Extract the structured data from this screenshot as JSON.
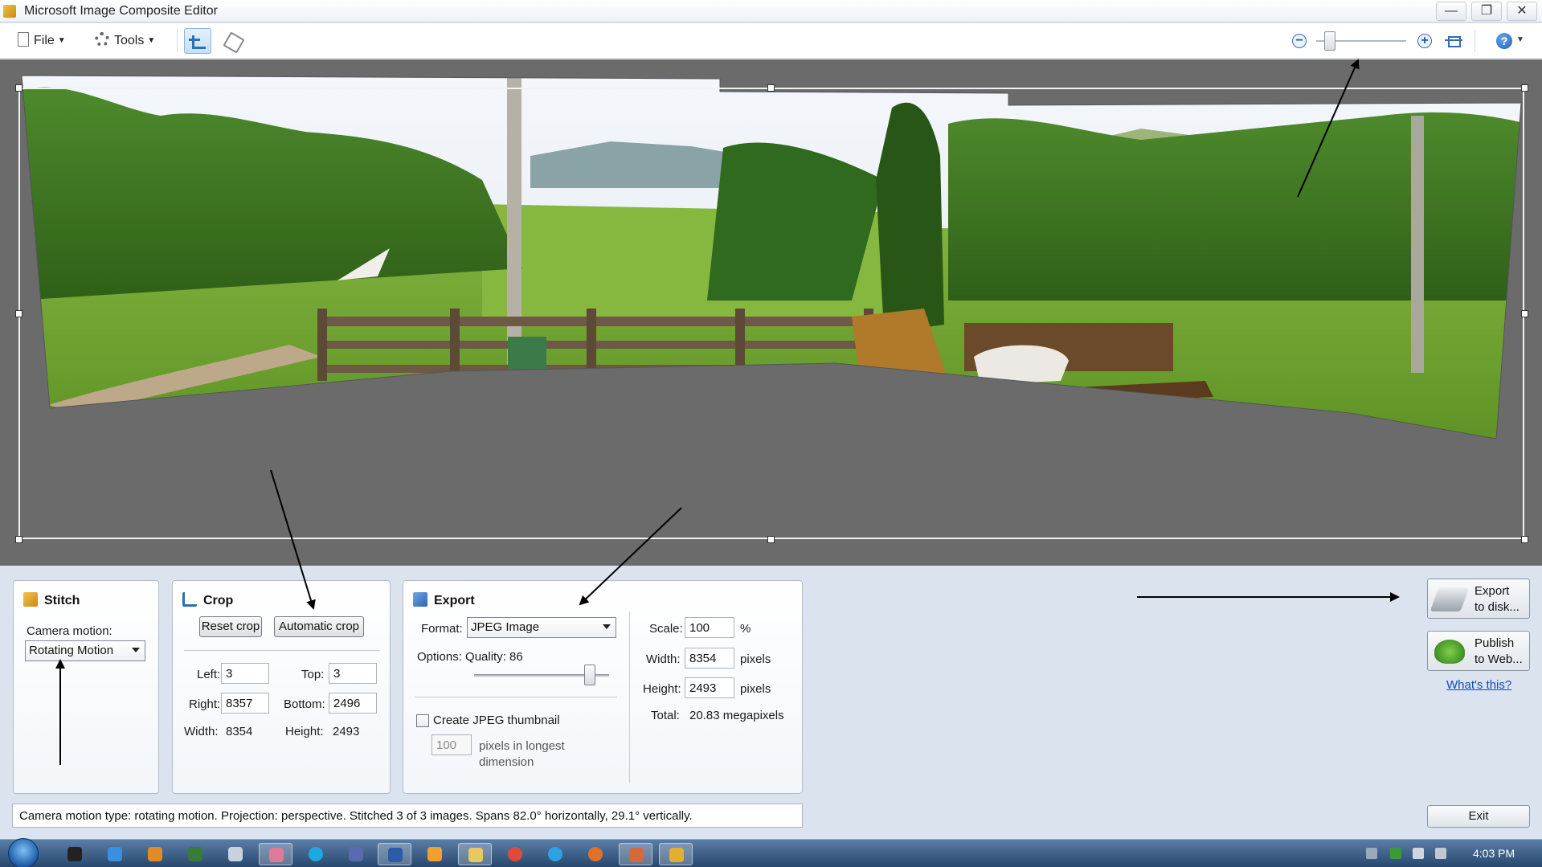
{
  "window": {
    "title": "Microsoft Image Composite Editor",
    "minimize": "—",
    "maximize": "❐",
    "close": "✕"
  },
  "toolbar": {
    "file_label": "File",
    "tools_label": "Tools",
    "zoom_out": "−",
    "zoom_in": "+",
    "help": "?",
    "zoom_level": 0.1
  },
  "stitch": {
    "title": "Stitch",
    "camera_motion_label": "Camera motion:",
    "camera_motion_value": "Rotating Motion"
  },
  "crop": {
    "title": "Crop",
    "reset_label": "Reset crop",
    "auto_label": "Automatic crop",
    "left_label": "Left:",
    "left_value": "3",
    "top_label": "Top:",
    "top_value": "3",
    "right_label": "Right:",
    "right_value": "8357",
    "bottom_label": "Bottom:",
    "bottom_value": "2496",
    "width_label": "Width:",
    "width_value": "8354",
    "height_label": "Height:",
    "height_value": "2493"
  },
  "export": {
    "title": "Export",
    "format_label": "Format:",
    "format_value": "JPEG Image",
    "options_label": "Options: Quality: 86",
    "quality": 86,
    "thumbnail_label": "Create JPEG thumbnail",
    "thumbnail_size": "100",
    "thumbnail_unit_1": "pixels in longest",
    "thumbnail_unit_2": "dimension",
    "scale_label": "Scale:",
    "scale_value": "100",
    "scale_unit": "%",
    "width_label": "Width:",
    "width_value": "8354",
    "width_unit": "pixels",
    "height_label": "Height:",
    "height_value": "2493",
    "height_unit": "pixels",
    "total_label": "Total:",
    "total_value": "20.83 megapixels"
  },
  "actions": {
    "export_disk_1": "Export",
    "export_disk_2": "to disk...",
    "publish_web_1": "Publish",
    "publish_web_2": "to Web...",
    "whats_this": "What's this?",
    "exit": "Exit"
  },
  "status_text": "Camera motion type: rotating motion. Projection: perspective. Stitched 3 of 3 images. Spans 82.0° horizontally, 29.1° vertically.",
  "taskbar": {
    "time": "4:03 PM"
  },
  "colors": {
    "canvas_bg": "#6b6b6b",
    "panel_bg": "#dbe4ee",
    "link": "#1747c7"
  }
}
